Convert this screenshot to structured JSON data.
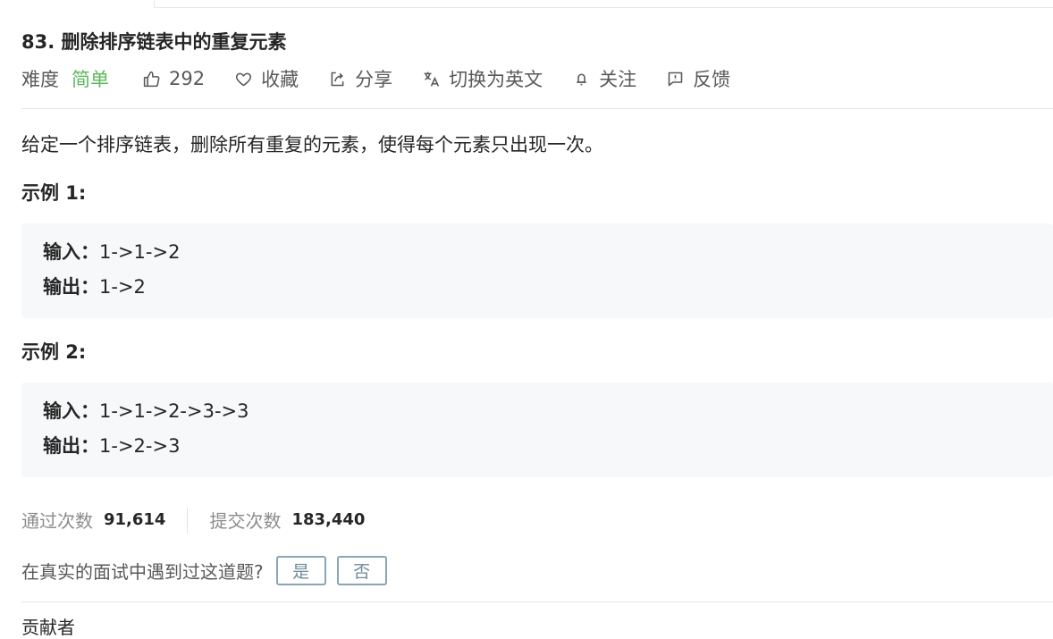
{
  "problem": {
    "title": "83. 删除排序链表中的重复元素",
    "difficulty_label": "难度",
    "difficulty": "简单",
    "likes": "292",
    "actions": {
      "favorite": "收藏",
      "share": "分享",
      "switch_lang": "切换为英文",
      "follow": "关注",
      "feedback": "反馈"
    },
    "description": "给定一个排序链表，删除所有重复的元素，使得每个元素只出现一次。",
    "examples": [
      {
        "title": "示例 1:",
        "input_label": "输入：",
        "input": "1->1->2",
        "output_label": "输出：",
        "output": "1->2"
      },
      {
        "title": "示例 2:",
        "input_label": "输入：",
        "input": "1->1->2->3->3",
        "output_label": "输出：",
        "output": "1->2->3"
      }
    ],
    "stats": {
      "accepted_label": "通过次数",
      "accepted": "91,614",
      "submissions_label": "提交次数",
      "submissions": "183,440"
    },
    "interview_question": {
      "prompt": "在真实的面试中遇到过这道题?",
      "yes": "是",
      "no": "否"
    },
    "next_section_partial": "贡献者"
  },
  "colors": {
    "difficulty_easy": "#5cb85c",
    "code_bg": "#f7f8fa",
    "button_border": "#8aa5b4"
  }
}
